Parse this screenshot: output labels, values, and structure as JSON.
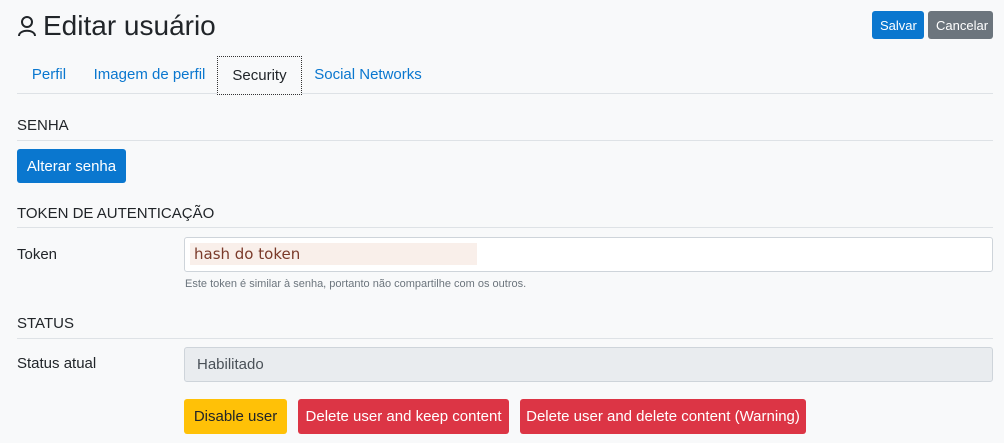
{
  "header": {
    "title": "Editar usuário",
    "save_label": "Salvar",
    "cancel_label": "Cancelar"
  },
  "tabs": [
    {
      "label": "Perfil",
      "active": false
    },
    {
      "label": "Imagem de perfil",
      "active": false
    },
    {
      "label": "Security",
      "active": true
    },
    {
      "label": "Social Networks",
      "active": false
    }
  ],
  "senha": {
    "title": "SENHA",
    "change_label": "Alterar senha"
  },
  "token": {
    "title": "TOKEN DE AUTENTICAÇÃO",
    "label": "Token",
    "value": "hash do token",
    "help": "Este token é similar à senha, portanto não compartilhe com os outros."
  },
  "status": {
    "title": "STATUS",
    "label": "Status atual",
    "value": "Habilitado",
    "disable_label": "Disable user",
    "delete_keep_label": "Delete user and keep content",
    "delete_all_label": "Delete user and delete content (Warning)"
  },
  "colors": {
    "primary": "#0a77cf",
    "secondary": "#6c757d",
    "warning": "#ffc107",
    "danger": "#dc3545"
  },
  "icons": {
    "title_icon": "user-icon"
  }
}
